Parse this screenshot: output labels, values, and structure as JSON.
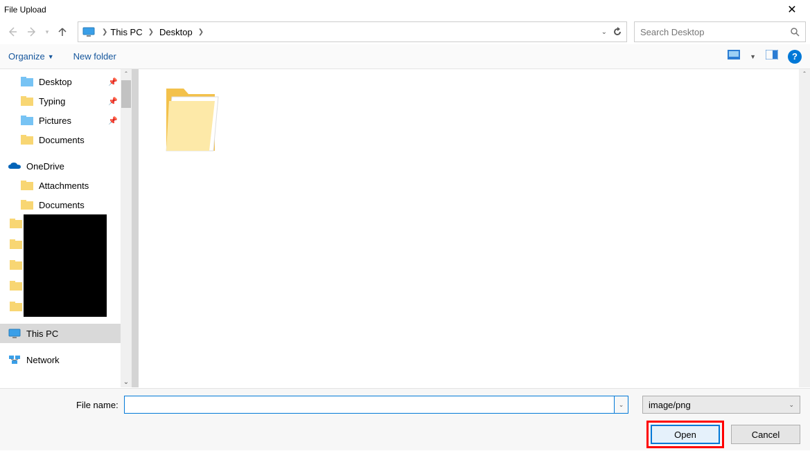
{
  "window": {
    "title": "File Upload"
  },
  "breadcrumb": {
    "items": [
      "This PC",
      "Desktop"
    ]
  },
  "search": {
    "placeholder": "Search Desktop"
  },
  "toolbar": {
    "organize": "Organize",
    "newfolder": "New folder"
  },
  "sidebar": {
    "quick": [
      {
        "label": "Desktop",
        "pinned": true
      },
      {
        "label": "Typing",
        "pinned": true
      },
      {
        "label": "Pictures",
        "pinned": true
      },
      {
        "label": "Documents",
        "pinned": false
      }
    ],
    "onedrive": {
      "label": "OneDrive",
      "children": [
        "Attachments",
        "Documents"
      ]
    },
    "thispc": {
      "label": "This PC"
    },
    "network": {
      "label": "Network"
    }
  },
  "filename": {
    "label": "File name:",
    "value": ""
  },
  "filetype": {
    "label": "image/png"
  },
  "buttons": {
    "open": "Open",
    "cancel": "Cancel"
  }
}
